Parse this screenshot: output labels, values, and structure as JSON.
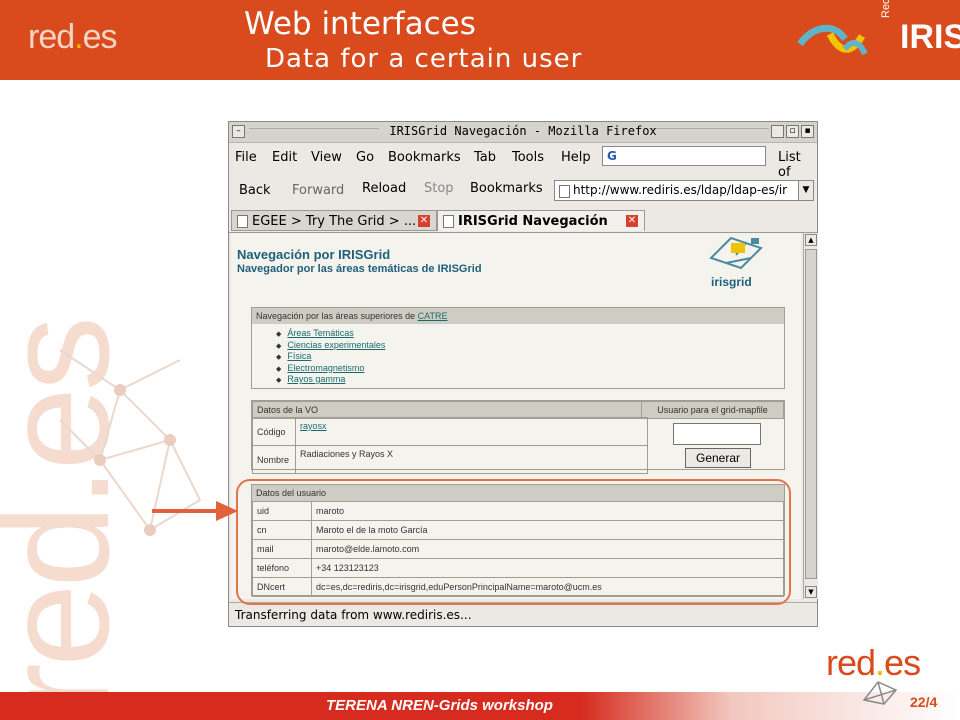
{
  "slide": {
    "title": "Web interfaces",
    "subtitle": "Data for a certain user",
    "logo_left": "red.es",
    "logo_right_small": "Red",
    "logo_right_big": "IRIS",
    "footer": "TERENA NREN-Grids workshop",
    "page": "22/4",
    "bottom_logo": "red.es",
    "watermark": "red.es",
    "colors": {
      "header": "#d94a1c",
      "highlight": "#e27449",
      "footer": "#d62b1e"
    }
  },
  "browser": {
    "window_title": "IRISGrid Navegación - Mozilla Firefox",
    "menu": [
      "File",
      "Edit",
      "View",
      "Go",
      "Bookmarks",
      "Tab",
      "Tools",
      "Help"
    ],
    "menu_overflow": "List of",
    "search_engine_icon": "G",
    "nav": {
      "back": "Back",
      "forward": "Forward",
      "reload": "Reload",
      "stop": "Stop",
      "bookmarks": "Bookmarks"
    },
    "url": "http://www.rediris.es/ldap/ldap-es/ir",
    "tabs": [
      {
        "label": "EGEE > Try The Grid > ...",
        "active": false
      },
      {
        "label": "IRISGrid Navegación",
        "active": true
      }
    ],
    "status": "Transferring data from www.rediris.es..."
  },
  "page": {
    "title": "Navegación por IRISGrid",
    "subtitle": "Navegador por las áreas temáticas de IRISGrid",
    "logo_word": "irisgrid",
    "areas_header": "Navegación por las áreas superiores de",
    "areas_header_link": "CATRE",
    "areas": [
      "Áreas Temáticas",
      "Ciencias experimentales",
      "Física",
      "Electromagnetismo",
      "Rayos gamma"
    ],
    "vo_header": "Datos de la VO",
    "vo_rows": [
      {
        "key": "Código",
        "value": "rayosx"
      },
      {
        "key": "Nombre",
        "value": "Radiaciones y Rayos X"
      }
    ],
    "mapfile_header": "Usuario para el grid-mapfile",
    "generate_button": "Generar",
    "user_header": "Datos del usuario",
    "user_rows": [
      {
        "key": "uid",
        "value": "maroto"
      },
      {
        "key": "cn",
        "value": "Maroto el de la moto García"
      },
      {
        "key": "mail",
        "value": "maroto@elde.lamoto.com"
      },
      {
        "key": "teléfono",
        "value": "+34 123123123"
      },
      {
        "key": "DNcert",
        "value": "dc=es,dc=rediris,dc=irisgrid,eduPersonPrincipalName=maroto@ucm.es"
      }
    ]
  }
}
